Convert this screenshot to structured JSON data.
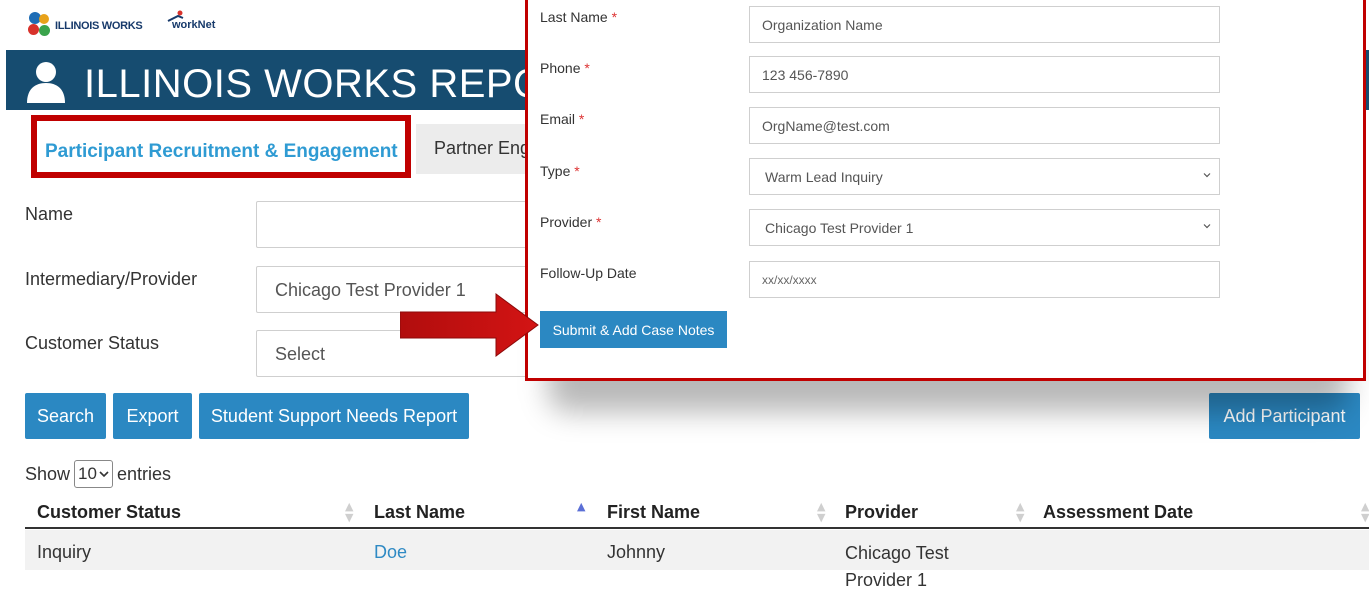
{
  "header": {
    "logo_left": "ILLINOIS WORKS",
    "logo_right": "workNet",
    "title": "ILLINOIS WORKS REPOR"
  },
  "tabs": [
    {
      "label": "Participant Recruitment & Engagement",
      "active": true,
      "highlighted": true
    },
    {
      "label": "Partner Eng",
      "active": false
    }
  ],
  "filters": {
    "name": {
      "label": "Name",
      "value": ""
    },
    "provider": {
      "label": "Intermediary/Provider",
      "value": "Chicago Test Provider 1"
    },
    "status": {
      "label": "Customer Status",
      "value": "Select"
    }
  },
  "actions": {
    "search": "Search",
    "export": "Export",
    "student_support": "Student Support Needs Report",
    "add_participant": "Add Participant"
  },
  "table": {
    "show_label": "Show",
    "page_size": "10",
    "entries_label": "entries",
    "columns": [
      "Customer Status",
      "Last Name",
      "First Name",
      "Provider",
      "Assessment Date"
    ],
    "sorted_column": "Last Name",
    "rows": [
      {
        "status": "Inquiry",
        "last_name": "Doe",
        "first_name": "Johnny",
        "provider": "Chicago Test Provider 1",
        "assessment_date": ""
      }
    ]
  },
  "modal": {
    "fields": [
      {
        "label": "Last Name",
        "required": true,
        "value": "Organization Name",
        "type": "text"
      },
      {
        "label": "Phone",
        "required": true,
        "value": "123 456-7890",
        "type": "text"
      },
      {
        "label": "Email",
        "required": true,
        "value": "OrgName@test.com",
        "type": "text"
      },
      {
        "label": "Type",
        "required": true,
        "value": "Warm Lead Inquiry",
        "type": "select"
      },
      {
        "label": "Provider",
        "required": true,
        "value": "Chicago Test Provider 1",
        "type": "select"
      },
      {
        "label": "Follow-Up Date",
        "required": false,
        "value": "xx/xx/xxxx",
        "type": "text"
      }
    ],
    "submit": "Submit & Add Case Notes",
    "required_mark": "*"
  },
  "colors": {
    "brand_blue": "#164c70",
    "button_blue": "#2b88c2",
    "highlight_red": "#c00000",
    "tab_text": "#2f9bd3",
    "link": "#2f8ac4"
  }
}
